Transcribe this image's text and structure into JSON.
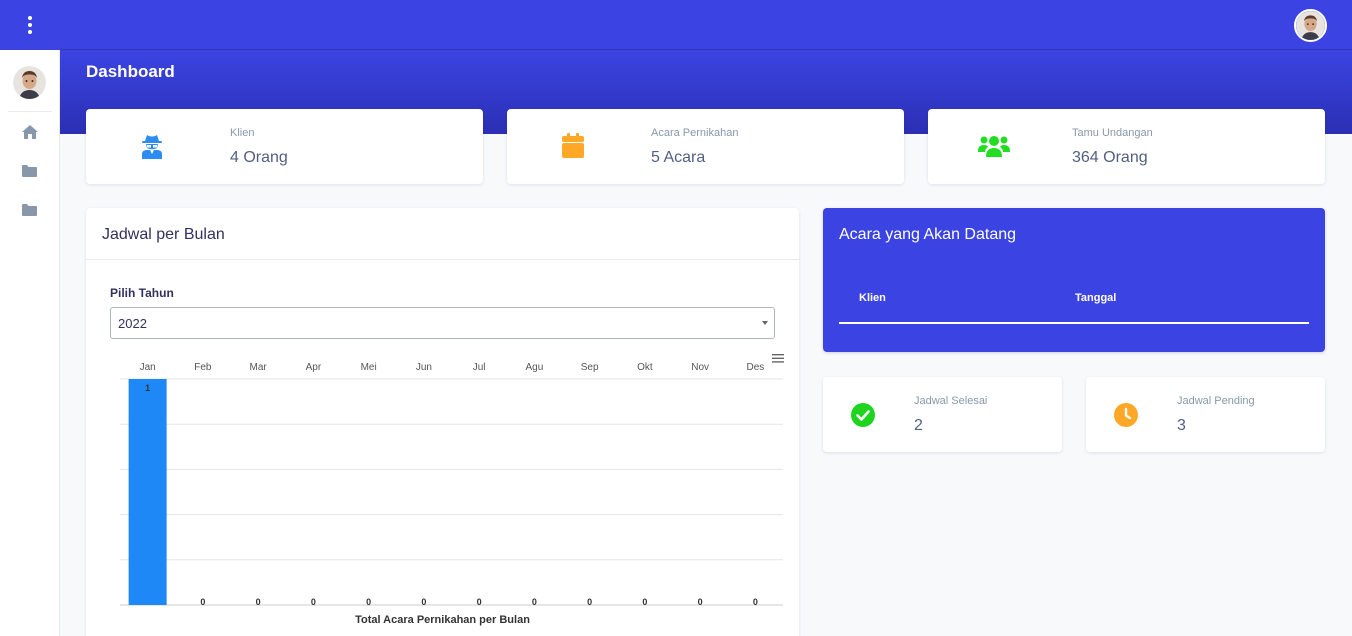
{
  "header": {
    "page_title": "Dashboard"
  },
  "sidebar": {
    "items": [
      {
        "icon": "home-icon"
      },
      {
        "icon": "folder-icon"
      },
      {
        "icon": "folder-icon"
      }
    ]
  },
  "stats": [
    {
      "label": "Klien",
      "value": "4 Orang",
      "icon": "user-secret-icon",
      "color": "#2d8cf0"
    },
    {
      "label": "Acara Pernikahan",
      "value": "5 Acara",
      "icon": "calendar-icon",
      "color": "#ffa726"
    },
    {
      "label": "Tamu Undangan",
      "value": "364 Orang",
      "icon": "users-icon",
      "color": "#22dd22"
    }
  ],
  "schedule": {
    "title": "Jadwal per Bulan",
    "year_label": "Pilih Tahun",
    "year_value": "2022"
  },
  "chart_data": {
    "type": "bar",
    "categories": [
      "Jan",
      "Feb",
      "Mar",
      "Apr",
      "Mei",
      "Jun",
      "Jul",
      "Agu",
      "Sep",
      "Okt",
      "Nov",
      "Des"
    ],
    "values": [
      1,
      0,
      0,
      0,
      0,
      0,
      0,
      0,
      0,
      0,
      0,
      0
    ],
    "title": "Total Acara Pernikahan per Bulan",
    "xlabel": "",
    "ylabel": "",
    "ylim": [
      0,
      1
    ],
    "bar_color": "#1e88f7",
    "grid": true,
    "data_labels": true
  },
  "upcoming": {
    "title": "Acara yang Akan Datang",
    "columns": [
      "Klien",
      "Tanggal"
    ]
  },
  "status_cards": [
    {
      "label": "Jadwal Selesai",
      "value": "2",
      "icon": "check-circle-icon",
      "color": "#1ed41e"
    },
    {
      "label": "Jadwal Pending",
      "value": "3",
      "icon": "clock-icon",
      "color": "#ffa726"
    }
  ],
  "colors": {
    "primary": "#3b44e2",
    "header_dark": "#2b2fb4"
  }
}
